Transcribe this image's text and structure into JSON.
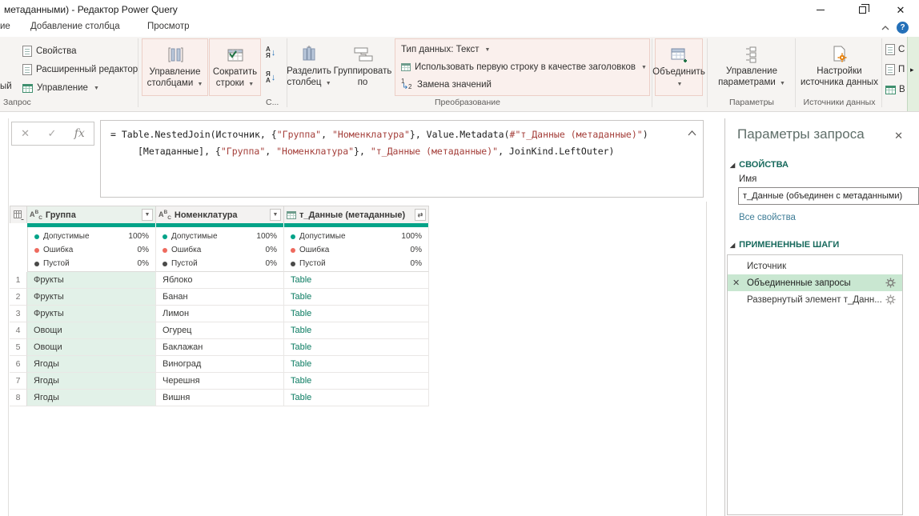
{
  "window": {
    "title": "метаданными) - Редактор Power Query"
  },
  "menu": {
    "tabs": [
      "ие",
      "Добавление столбца",
      "Просмотр"
    ]
  },
  "ribbon": {
    "left_fragment": "ый",
    "query": {
      "properties": "Свойства",
      "advanced_editor": "Расширенный редактор",
      "manage": "Управление",
      "label": "Запрос"
    },
    "manage_columns": "Управление столбцами",
    "reduce_rows": "Сократить строки",
    "sort_label": "С...",
    "split_column": "Разделить столбец",
    "group_by": "Группировать по",
    "data_type": "Тип данных: Текст",
    "use_first_row": "Использовать первую строку в качестве заголовков",
    "replace_values": "Замена значений",
    "transform_label": "Преобразование",
    "combine": "Объединить",
    "manage_parameters": "Управление параметрами",
    "parameters_label": "Параметры",
    "data_source_settings": "Настройки источника данных",
    "data_sources_label": "Источники данных",
    "right_truncated": [
      "С",
      "П",
      "В"
    ]
  },
  "formula": {
    "line1": [
      "= Table.NestedJoin(Источник, {",
      "\"Группа\"",
      ", ",
      "\"Номенклатура\"",
      "}, Value.Metadata(",
      "#\"т_Данные (метаданные)\"",
      ")"
    ],
    "line2": [
      "[Метаданные], {",
      "\"Группа\"",
      ", ",
      "\"Номенклатура\"",
      "}, ",
      "\"т_Данные (метаданные)\"",
      ", JoinKind.LeftOuter)"
    ]
  },
  "grid": {
    "columns": [
      {
        "name": "Группа",
        "type": "text",
        "quality": [
          {
            "label": "Допустимые",
            "value": "100%"
          },
          {
            "label": "Ошибка",
            "value": "0%"
          },
          {
            "label": "Пустой",
            "value": "0%"
          }
        ]
      },
      {
        "name": "Номенклатура",
        "type": "text",
        "quality": [
          {
            "label": "Допустимые",
            "value": "100%"
          },
          {
            "label": "Ошибка",
            "value": "0%"
          },
          {
            "label": "Пустой",
            "value": "0%"
          }
        ]
      },
      {
        "name": "т_Данные (метаданные)",
        "type": "table",
        "quality": [
          {
            "label": "Допустимые",
            "value": "100%"
          },
          {
            "label": "Ошибка",
            "value": "0%"
          },
          {
            "label": "Пустой",
            "value": "0%"
          }
        ]
      }
    ],
    "rows": [
      {
        "n": "1",
        "group": "Фрукты",
        "item": "Яблоко",
        "value": "Table"
      },
      {
        "n": "2",
        "group": "Фрукты",
        "item": "Банан",
        "value": "Table"
      },
      {
        "n": "3",
        "group": "Фрукты",
        "item": "Лимон",
        "value": "Table"
      },
      {
        "n": "4",
        "group": "Овощи",
        "item": "Огурец",
        "value": "Table"
      },
      {
        "n": "5",
        "group": "Овощи",
        "item": "Баклажан",
        "value": "Table"
      },
      {
        "n": "6",
        "group": "Ягоды",
        "item": "Виноград",
        "value": "Table"
      },
      {
        "n": "7",
        "group": "Ягоды",
        "item": "Черешня",
        "value": "Table"
      },
      {
        "n": "8",
        "group": "Ягоды",
        "item": "Вишня",
        "value": "Table"
      }
    ]
  },
  "panel": {
    "title": "Параметры запроса",
    "properties_header": "СВОЙСТВА",
    "name_label": "Имя",
    "name_value": "т_Данные (объединен с метаданными)",
    "all_properties": "Все свойства",
    "steps_header": "ПРИМЕНЕННЫЕ ШАГИ",
    "steps": [
      {
        "label": "Источник",
        "selected": false
      },
      {
        "label": "Объединенные запросы",
        "selected": true
      },
      {
        "label": "Развернутый элемент т_Данн...",
        "selected": false,
        "has_settings": true
      }
    ]
  },
  "colors": {
    "quality_teal": "#02a388",
    "selection_mint": "#c9e7d1",
    "column_mint": "#e2f1e8",
    "link_teal": "#0b7c62",
    "string_red": "#a43e39",
    "help_blue": "#2470b8",
    "highlight_pink": "#faf0ed",
    "section_header_teal": "#17695c"
  }
}
